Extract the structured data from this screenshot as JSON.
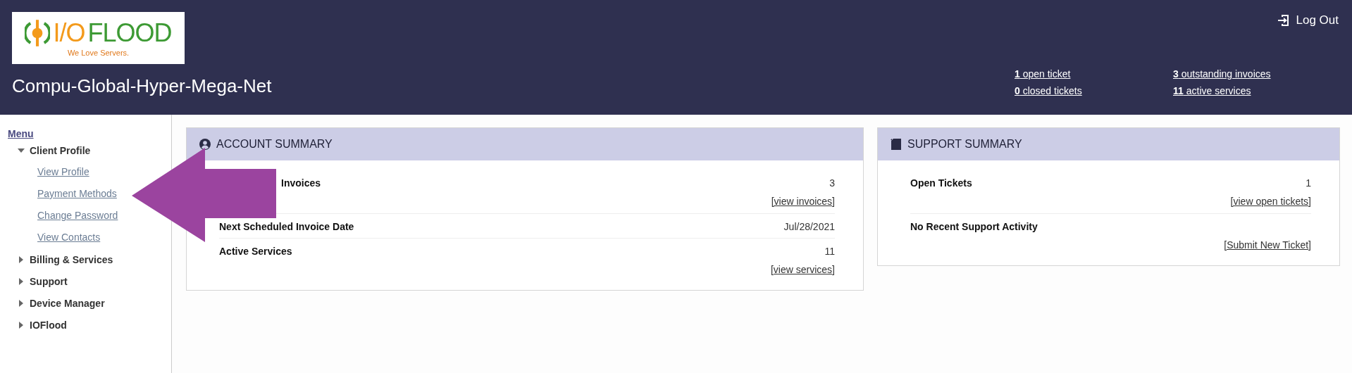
{
  "header": {
    "logo": {
      "mark": "I/O",
      "word": "FLOOD",
      "tagline": "We Love Servers."
    },
    "company": "Compu-Global-Hyper-Mega-Net",
    "logout": "Log Out",
    "stats": [
      {
        "text": "**1** open ticket"
      },
      {
        "text": "**3** outstanding invoices"
      },
      {
        "text": "**0** closed tickets"
      },
      {
        "text": "**11** active services"
      }
    ]
  },
  "sidebar": {
    "title": "Menu",
    "items": [
      {
        "label": "Client Profile",
        "expanded": true,
        "children": [
          {
            "label": "View Profile"
          },
          {
            "label": "Payment Methods"
          },
          {
            "label": "Change Password"
          },
          {
            "label": "View Contacts"
          }
        ]
      },
      {
        "label": "Billing & Services",
        "expanded": false
      },
      {
        "label": "Support",
        "expanded": false
      },
      {
        "label": "Device Manager",
        "expanded": false
      },
      {
        "label": "IOFlood",
        "expanded": false
      }
    ]
  },
  "panels": [
    {
      "kind": "account",
      "title": "ACCOUNT SUMMARY",
      "rows": [
        {
          "label": "Invoices",
          "value": "3",
          "link": "[view invoices]"
        },
        {
          "label": "Next Scheduled Invoice Date",
          "value": "Jul/28/2021"
        },
        {
          "label": "Active Services",
          "value": "11",
          "link": "[view services]"
        }
      ]
    },
    {
      "kind": "support",
      "title": "SUPPORT SUMMARY",
      "rows": [
        {
          "label": "Open Tickets",
          "value": "1",
          "link": "[view open tickets]"
        },
        {
          "label": "No Recent Support Activity",
          "link": "[Submit New Ticket]"
        }
      ]
    }
  ],
  "annotations": [
    {
      "kind": "arrow"
    }
  ]
}
